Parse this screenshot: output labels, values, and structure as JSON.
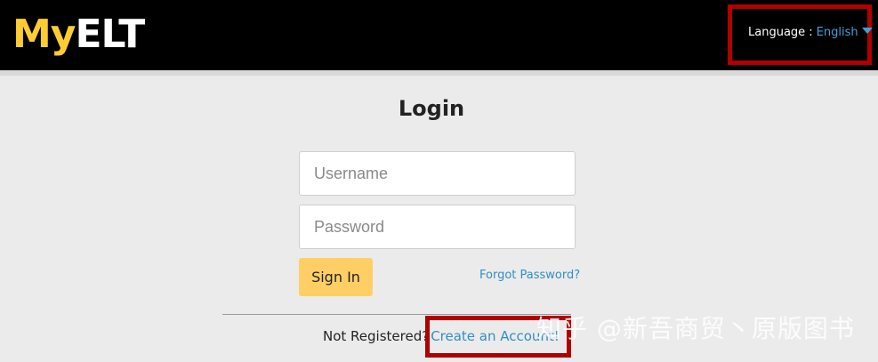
{
  "header": {
    "logo_part1": "My",
    "logo_part2": "ELT",
    "language_label": "Language :",
    "language_value": "English"
  },
  "login": {
    "title": "Login",
    "username_placeholder": "Username",
    "password_placeholder": "Password",
    "signin_label": "Sign In",
    "forgot_label": "Forgot Password?"
  },
  "register": {
    "prompt": "Not Registered?",
    "link_label": "Create an Account!"
  },
  "watermark": "知乎 @新吾商贸丶原版图书",
  "colors": {
    "topbar": "#000000",
    "logo_yellow": "#ffcc33",
    "link_blue": "#2f8fc4",
    "signin_bg": "#ffcf66",
    "highlight_red": "#b00000",
    "page_bg": "#ebebeb"
  },
  "icons": {
    "language_caret": "chevron-down-icon"
  }
}
